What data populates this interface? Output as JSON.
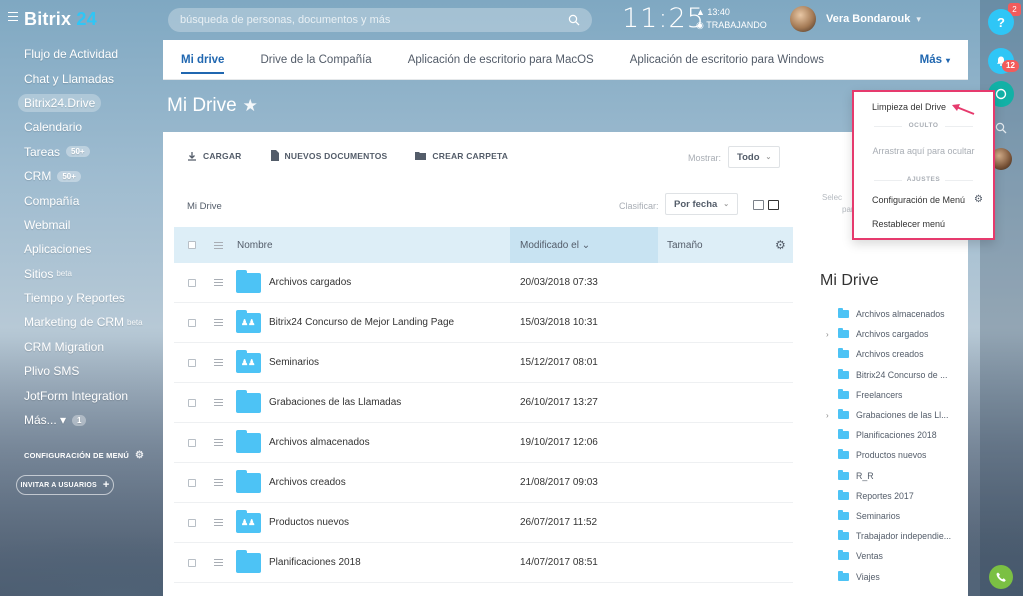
{
  "header": {
    "logo_text": "Bitrix",
    "logo_suffix": "24",
    "search_placeholder": "búsqueda de personas, documentos y más",
    "clock": "11:25",
    "clock_alarm": "▲ 13:40",
    "status": "◉ TRABAJANDO",
    "user_name": "Vera Bondarouk",
    "user_caret": "▾"
  },
  "rail": {
    "help": "?",
    "corner_badge": "2",
    "bell_badge": "12"
  },
  "sidebar": {
    "items": [
      {
        "label": "Flujo de Actividad"
      },
      {
        "label": "Chat y Llamadas"
      },
      {
        "label": "Bitrix24.Drive"
      },
      {
        "label": "Calendario"
      },
      {
        "label": "Tareas",
        "count": "50+"
      },
      {
        "label": "CRM",
        "count": "50+"
      },
      {
        "label": "Compañía"
      },
      {
        "label": "Webmail"
      },
      {
        "label": "Aplicaciones"
      },
      {
        "label": "Sitios",
        "sup": "beta"
      },
      {
        "label": "Tiempo y Reportes"
      },
      {
        "label": "Marketing de CRM",
        "sup": "beta"
      },
      {
        "label": "CRM Migration"
      },
      {
        "label": "Plivo SMS"
      },
      {
        "label": "JotForm Integration"
      },
      {
        "label": "Más... ▾",
        "count": "1"
      }
    ],
    "settings_label": "CONFIGURACIÓN DE MENÚ",
    "invite_label": "INVITAR A USUARIOS"
  },
  "tabs": {
    "items": [
      "Mi drive",
      "Drive de la Compañía",
      "Aplicación de escritorio para MacOS",
      "Aplicación de escritorio para Windows"
    ],
    "more": "Más"
  },
  "page": {
    "title": "Mi Drive",
    "star": "★"
  },
  "toolbar": {
    "upload": "CARGAR",
    "new_docs": "NUEVOS DOCUMENTOS",
    "create_folder": "CREAR CARPETA",
    "show_label": "Mostrar:",
    "show_value": "Todo",
    "breadcrumb": "Mi Drive",
    "sort_label": "Clasificar:",
    "sort_value": "Por fecha"
  },
  "grid": {
    "col_name": "Nombre",
    "col_modified": "Modificado el ⌄",
    "col_size": "Tamaño",
    "rows": [
      {
        "name": "Archivos cargados",
        "date": "20/03/2018 07:33",
        "shared": false
      },
      {
        "name": "Bitrix24 Concurso de Mejor Landing Page",
        "date": "15/03/2018 10:31",
        "shared": true
      },
      {
        "name": "Seminarios",
        "date": "15/12/2017 08:01",
        "shared": true
      },
      {
        "name": "Grabaciones de las Llamadas",
        "date": "26/10/2017 13:27",
        "shared": false
      },
      {
        "name": "Archivos almacenados",
        "date": "19/10/2017 12:06",
        "shared": false
      },
      {
        "name": "Archivos creados",
        "date": "21/08/2017 09:03",
        "shared": false
      },
      {
        "name": "Productos nuevos",
        "date": "26/07/2017 11:52",
        "shared": true
      },
      {
        "name": "Planificaciones 2018",
        "date": "14/07/2017 08:51",
        "shared": false
      }
    ]
  },
  "right_panel": {
    "hint_line1": "Selec",
    "hint_line2": "par",
    "title": "Mi Drive",
    "tree": [
      {
        "label": "Archivos almacenados",
        "arrow": false
      },
      {
        "label": "Archivos cargados",
        "arrow": true
      },
      {
        "label": "Archivos creados",
        "arrow": false
      },
      {
        "label": "Bitrix24 Concurso de ...",
        "arrow": false
      },
      {
        "label": "Freelancers",
        "arrow": false
      },
      {
        "label": "Grabaciones de las Ll...",
        "arrow": true
      },
      {
        "label": "Planificaciones 2018",
        "arrow": false
      },
      {
        "label": "Productos nuevos",
        "arrow": false
      },
      {
        "label": "R_R",
        "arrow": false
      },
      {
        "label": "Reportes 2017",
        "arrow": false
      },
      {
        "label": "Seminarios",
        "arrow": false
      },
      {
        "label": "Trabajador independie...",
        "arrow": false
      },
      {
        "label": "Ventas",
        "arrow": false
      },
      {
        "label": "Viajes",
        "arrow": false
      }
    ]
  },
  "menu": {
    "cleanup": "Limpieza del Drive",
    "hidden_section": "OCULTO",
    "drag_hint": "Arrastra aquí para ocultar",
    "settings_section": "AJUSTES",
    "menu_config": "Configuración de Menú",
    "reset_menu": "Restablecer menú"
  },
  "colors": {
    "accent": "#2fc6f6",
    "link": "#2067b0",
    "highlight_border": "#e63a6d",
    "folder": "#4dc3f5"
  }
}
